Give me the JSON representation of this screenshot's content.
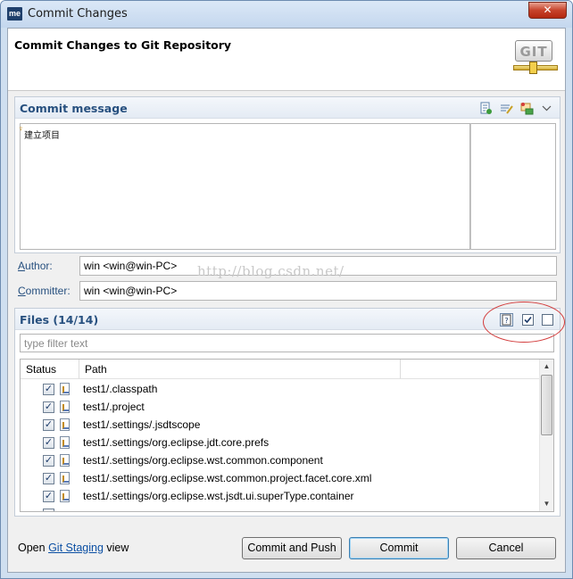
{
  "window": {
    "app_icon_text": "me",
    "title": "Commit Changes",
    "close_symbol": "✕"
  },
  "header": {
    "title": "Commit Changes to Git Repository",
    "logo_text": "GIT"
  },
  "commit_message": {
    "section_title": "Commit message",
    "text": "建立项目",
    "toolbar_icons": [
      "amend-icon",
      "signoff-icon",
      "change-id-icon",
      "view-menu-chevron-icon"
    ]
  },
  "author": {
    "label_prefix": "A",
    "label_rest": "uthor:",
    "value": "win <win@win-PC>"
  },
  "committer": {
    "label_prefix": "C",
    "label_rest": "ommitter:",
    "value": "win <win@win-PC>"
  },
  "watermark": "http://blog.csdn.net/",
  "files": {
    "section_title": "Files (14/14)",
    "filter_placeholder": "type filter text",
    "columns": [
      "Status",
      "Path"
    ],
    "rows": [
      {
        "checked": true,
        "path": "test1/.classpath"
      },
      {
        "checked": true,
        "path": "test1/.project"
      },
      {
        "checked": true,
        "path": "test1/.settings/.jsdtscope"
      },
      {
        "checked": true,
        "path": "test1/.settings/org.eclipse.jdt.core.prefs"
      },
      {
        "checked": true,
        "path": "test1/.settings/org.eclipse.wst.common.component"
      },
      {
        "checked": true,
        "path": "test1/.settings/org.eclipse.wst.common.project.facet.core.xml"
      },
      {
        "checked": true,
        "path": "test1/.settings/org.eclipse.wst.jsdt.ui.superType.container"
      }
    ]
  },
  "footer": {
    "open_text": "Open",
    "link_text": "Git Staging",
    "view_text": "view",
    "commit_push_label": "Commit and Push",
    "commit_label": "Commit",
    "cancel_label": "Cancel"
  }
}
